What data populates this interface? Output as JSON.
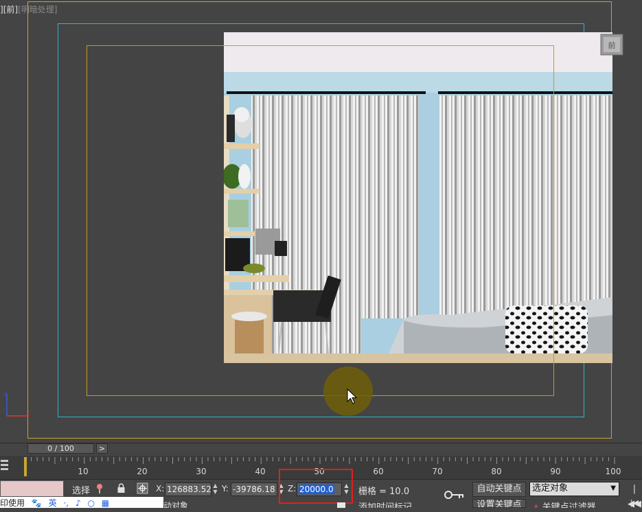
{
  "viewport": {
    "label_view": "[前]",
    "label_shading": "[明暗处理]",
    "label_prefix": "]"
  },
  "timeline": {
    "frame_display": "0 / 100",
    "next_label": ">",
    "ticks": [
      "10",
      "20",
      "30",
      "40",
      "50",
      "60",
      "70",
      "80",
      "90",
      "100"
    ]
  },
  "status": {
    "select_label": "选择",
    "x_label": "X:",
    "x_value": "126883.52",
    "y_label": "Y:",
    "y_value": "-39786.18",
    "z_label": "Z:",
    "z_value": "20000.0",
    "grid_label": "栅格 = 10.0",
    "add_time_tag": "添加时间标记",
    "auto_key": "自动关键点",
    "set_key": "设置关键点",
    "selected_dropdown": "选定对象",
    "key_filters": "关键点过滤器",
    "bottom_partial": "动对象",
    "print_text": "印使用"
  },
  "ime": {
    "lang": "英",
    "punct": "·,",
    "voice": "♪"
  },
  "icons": {
    "pin": "pin-icon",
    "lock": "lock-icon",
    "absolute": "absolute-mode-icon",
    "key": "key-icon",
    "goto_start": "goto-start-icon"
  },
  "colors": {
    "viewport_bg": "#444444",
    "safe_frame": "#c8a628",
    "action_safe": "#2fb6c8",
    "title_safe": "#c79a24",
    "highlight": "#e02020",
    "selection": "#1f5fd0"
  }
}
